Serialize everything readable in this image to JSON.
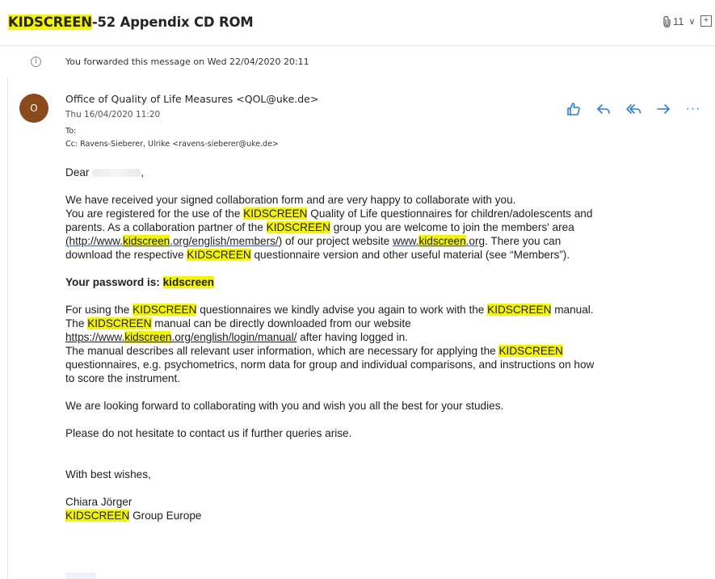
{
  "subject": {
    "hl": "KIDSCREEN",
    "rest": "-52 Appendix CD ROM"
  },
  "attachments": {
    "count": "11",
    "chevron": "∨",
    "expand": "⊞"
  },
  "notice": "You forwarded this message on Wed 22/04/2020 20:11",
  "sender": {
    "initial": "O",
    "from": "Office of Quality of Life Measures <QOL@uke.de>",
    "date": "Thu 16/04/2020 11:20",
    "to": "To:",
    "cc": "Cc:  Ravens-Sieberer, Ulrike <ravens-sieberer@uke.de>"
  },
  "actions": {
    "more": "···"
  },
  "kw": "KIDSCREEN",
  "body": {
    "greeting": "Dear",
    "p1_l1": "We have received your signed collaboration form and are very happy to collaborate with you.",
    "p1_l2a": "You are registered for the use of the ",
    "p1_l2b": " Quality of Life questionnaires for children/adolescents and",
    "p1_l3a": "parents.  As a collaboration partner of the ",
    "p1_l3b": " group you are welcome to join the members' area",
    "p1_l4_link_a": "(http://www.",
    "p1_l4_link_hl": "kidscreen",
    "p1_l4_link_b": ".org/english/members/",
    "p1_l4_mid": ") of our project website ",
    "p1_l4_site_a": "www.",
    "p1_l4_site_hl": "kidscreen",
    "p1_l4_site_b": ".org",
    "p1_l4_end": ". There you can",
    "p1_l5a": "download the respective ",
    "p1_l5b": " questionnaire version and other useful material (see “Members”).",
    "password_label": "Your password is: ",
    "password": "kidscreen",
    "p2_l1a": "For using the ",
    "p2_l1b": " questionnaires we kindly advise you again to work with the ",
    "p2_l1c": " manual.",
    "p2_l2a": "The ",
    "p2_l2b": " manual can be directly downloaded from our website",
    "p2_l3_a": "https://www.",
    "p2_l3_hl": "kidscreen",
    "p2_l3_b": ".org/english/login/manual/",
    "p2_l3_end": " after having logged in.",
    "p2_l4a": "The manual describes all relevant user information, which are necessary for applying the ",
    "p2_l5": "questionnaires, e.g. psychometrics, norm data for group and individual comparisons, and instructions on how",
    "p2_l6": "to score the instrument.",
    "p3": "We are looking forward to collaborating with you and wish you all the best for your studies.",
    "p4": "Please do not hesitate to contact us if further queries arise.",
    "closing": "With best wishes,",
    "signature_name": "Chiara Jörger",
    "signature_org_rest": " Group Europe"
  }
}
